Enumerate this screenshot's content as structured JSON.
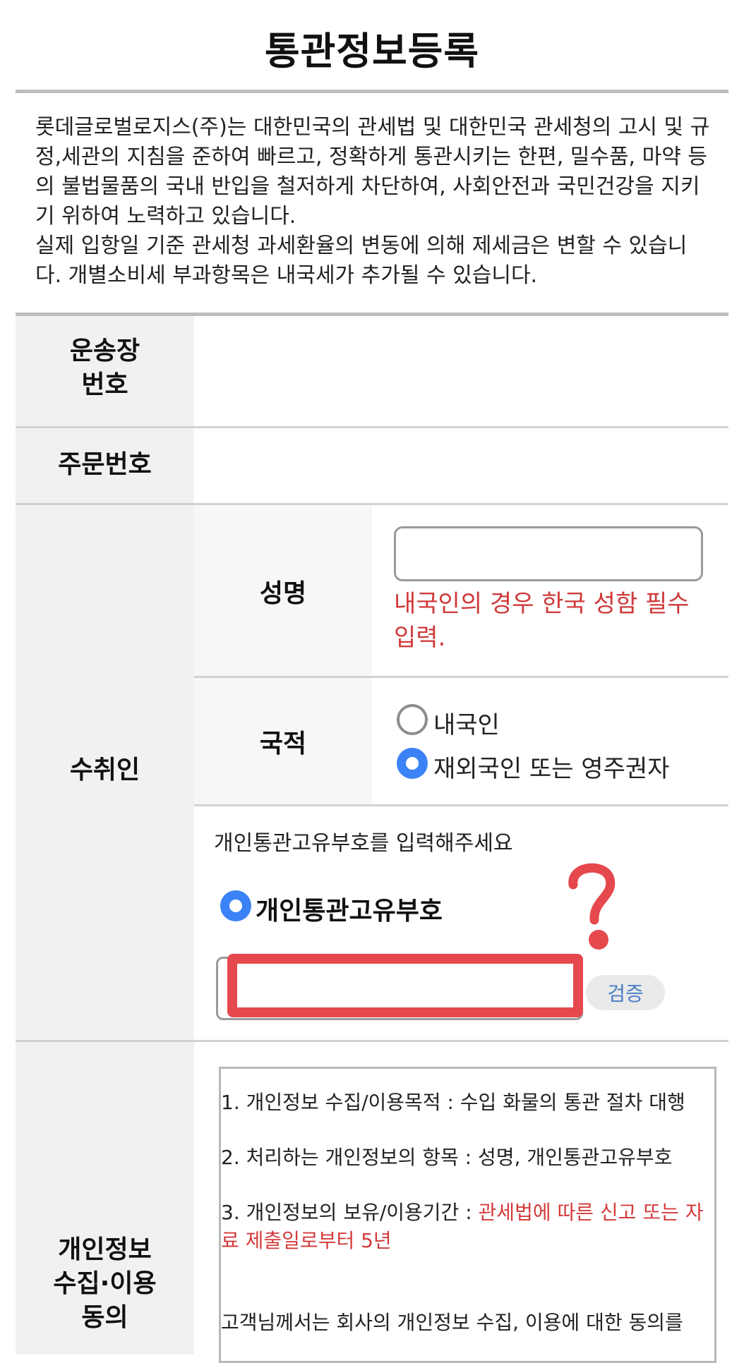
{
  "page": {
    "title": "통관정보등록"
  },
  "intro": {
    "paragraph1": "롯데글로벌로지스(주)는 대한민국의 관세법 및 대한민국 관세청의 고시 및 규정,세관의 지침을 준하여 빠르고, 정확하게 통관시키는 한편, 밀수품, 마약 등의 불법물품의 국내 반입을 철저하게 차단하여, 사회안전과 국민건강을 지키기 위하여 노력하고 있습니다.",
    "paragraph2": "실제 입항일 기준 관세청 과세환율의 변동에 의해 제세금은 변할 수 있습니다. 개별소비세 부과항목은 내국세가 추가될 수 있습니다."
  },
  "form": {
    "waybill_label": "운송장 번호",
    "waybill_value": "",
    "order_label": "주문번호",
    "order_value": "",
    "recipient_label": "수취인",
    "name_label": "성명",
    "name_value": "",
    "name_warning": "내국인의 경우 한국 성함 필수 입력.",
    "nationality_label": "국적",
    "nationality_options": [
      {
        "label": "내국인",
        "selected": false
      },
      {
        "label": "재외국인 또는 영주권자",
        "selected": true
      }
    ],
    "pccc_hint": "개인통관고유부호를 입력해주세요",
    "pccc_option_label": "개인통관고유부호",
    "pccc_value": "",
    "verify_button": "검증",
    "consent_label": "개인정보 수집·이용 동의"
  },
  "consent": {
    "item1": "1. 개인정보 수집/이용목적 : 수입 화물의 통관 절차 대행",
    "item2": "2. 처리하는 개인정보의 항목 : 성명, 개인통관고유부호",
    "item3_prefix": "3. 개인정보의 보유/이용기간 : ",
    "item3_highlight": "관세법에 따른 신고 또는 자료 제출일로부터 5년",
    "closing": "고객님께서는 회사의 개인정보 수집, 이용에 대한 동의를"
  },
  "colors": {
    "accent": "#3b82f6",
    "warning": "#cf3a3a",
    "annotation": "#e5484d"
  }
}
